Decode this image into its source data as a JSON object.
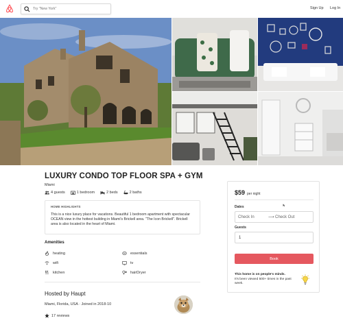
{
  "header": {
    "search_placeholder": "Try \"New York\"",
    "signup_label": "Sign Up",
    "login_label": "Log In"
  },
  "listing": {
    "title": "LUXURY CONDO TOP FLOOR SPA + GYM",
    "city": "Miami",
    "facts": {
      "guests": "4 guests",
      "bedrooms": "1 bedroom",
      "beds": "2 beds",
      "baths": "2 baths"
    },
    "highlights_heading": "HOME HIGHLIGHTS",
    "highlights_text": "This is a nice luxury place for vacations. Beautiful 1 bedroom apartment with spectacular OCEAN view in the hottest building in Miami's Brickell area. \"The Icon Brickell\". Brickell area is also located in the heart of Miami."
  },
  "amenities": {
    "heading": "Amenities",
    "items": [
      {
        "label": "heating",
        "icon": "heating-icon"
      },
      {
        "label": "essentials",
        "icon": "essentials-icon"
      },
      {
        "label": "wifi",
        "icon": "wifi-icon"
      },
      {
        "label": "tv",
        "icon": "tv-icon"
      },
      {
        "label": "kitchen",
        "icon": "kitchen-icon"
      },
      {
        "label": "hairDryer",
        "icon": "hairdryer-icon"
      }
    ]
  },
  "host": {
    "heading": "Hosted by Haupt",
    "meta": "Miami, Florida, USA · Joined in 2018-10",
    "reviews": "17 reviews"
  },
  "booking": {
    "price": "$59",
    "price_unit": "per night",
    "dates_label": "Dates",
    "check_in_placeholder": "Check In",
    "check_out_placeholder": "Check Out",
    "arrow": "⟶",
    "guests_label": "Guests",
    "guests_value": "1",
    "book_label": "Book",
    "tip_bold": "This home is on people's minds.",
    "tip_text": "It's been viewed 500+ times in the past week."
  },
  "colors": {
    "brand": "#ff5a5f",
    "book_button": "#e5585f"
  }
}
